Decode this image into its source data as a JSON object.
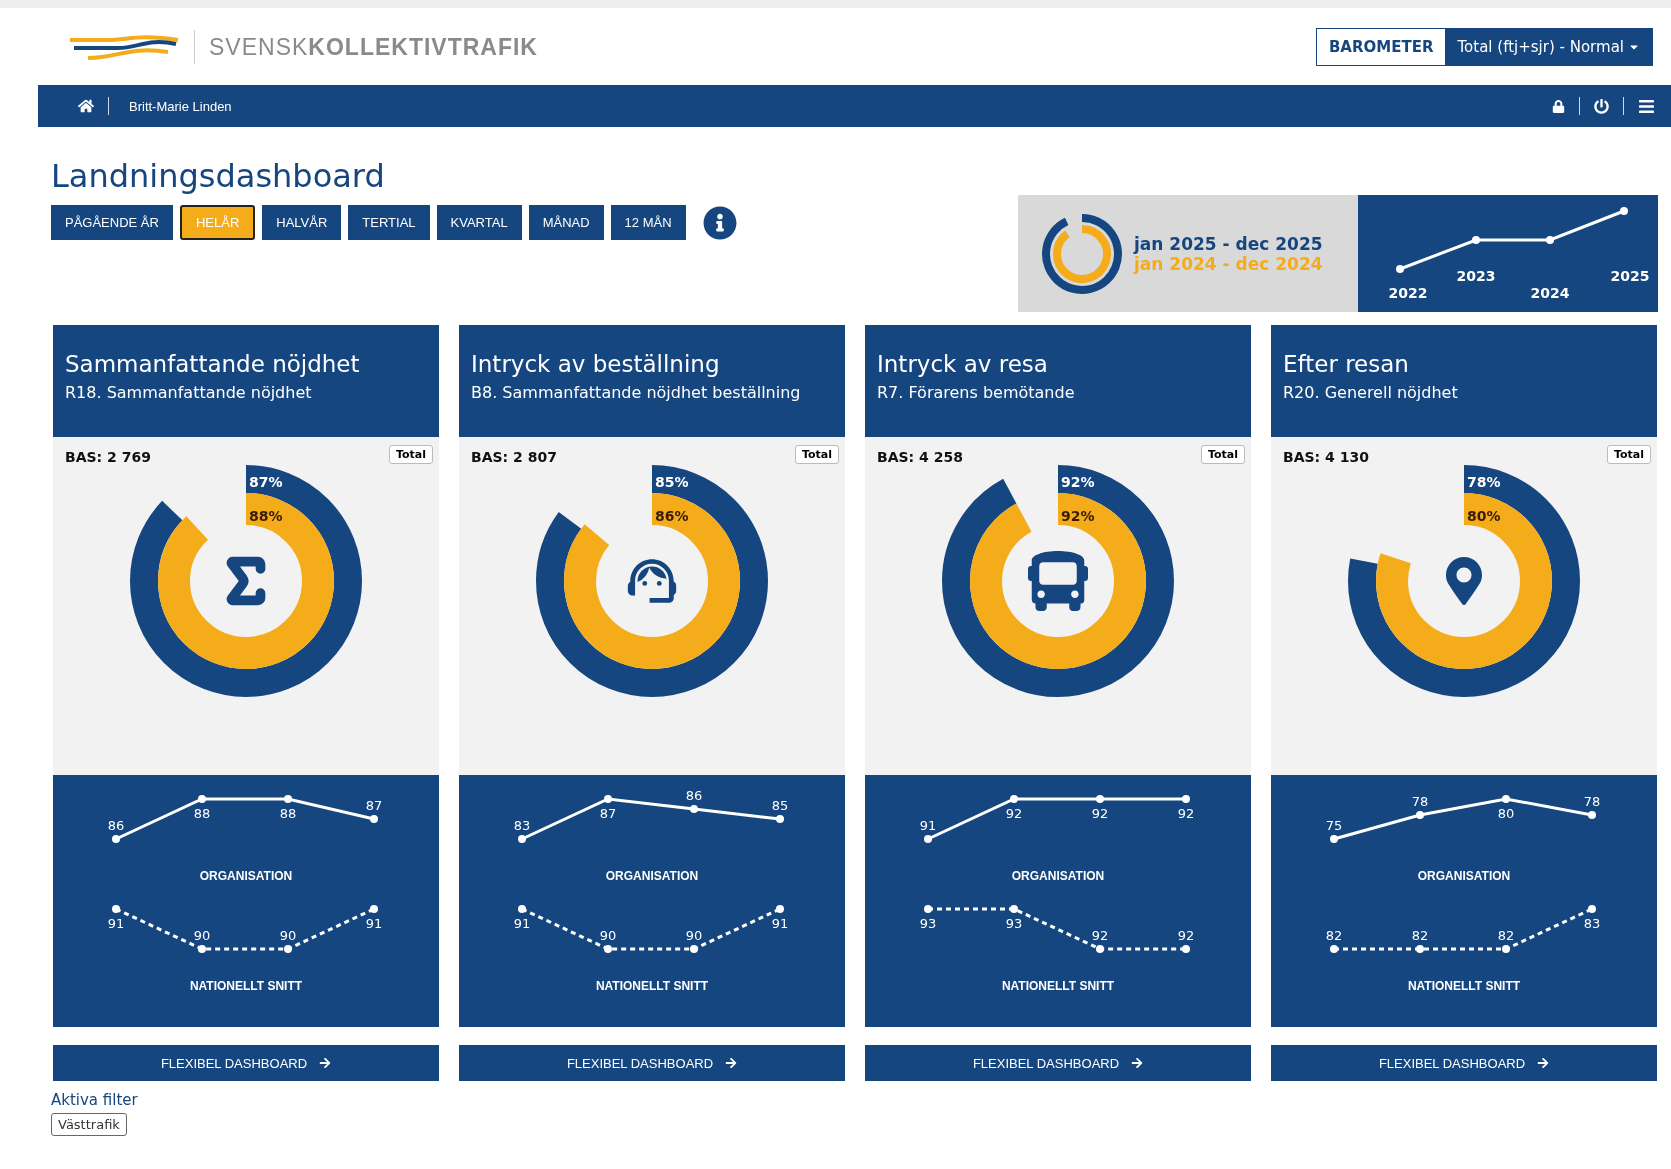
{
  "brand": {
    "wordmark": "SVENSK**KOLLEKTIVTRAFIK**"
  },
  "barometer": {
    "label": "BAROMETER",
    "value": "Total (ftj+sjr) - Normal"
  },
  "navbar": {
    "user": "Britt-Marie Linden"
  },
  "page_title": "Landningsdashboard",
  "periods": [
    {
      "label": "PÅGÅENDE ÅR",
      "selected": false
    },
    {
      "label": "HELÅR",
      "selected": true
    },
    {
      "label": "HALVÅR",
      "selected": false
    },
    {
      "label": "TERTIAL",
      "selected": false
    },
    {
      "label": "KVARTAL",
      "selected": false
    },
    {
      "label": "MÅNAD",
      "selected": false
    },
    {
      "label": "12 MÅN",
      "selected": false
    }
  ],
  "legend": {
    "current": "jan 2025 - dec 2025",
    "previous": "jan 2024 - dec 2024"
  },
  "trend": {
    "years": [
      "2022",
      "2023",
      "2024",
      "2025"
    ]
  },
  "cards": [
    {
      "title": "Sammanfattande nöjdhet",
      "subtitle": "R18. Sammanfattande nöjdhet",
      "base": "BAS: 2 769",
      "tag": "Total",
      "outer": {
        "label": "87%",
        "level": 0.87
      },
      "inner": {
        "label": "88%",
        "level": 0.88
      },
      "trends": [
        {
          "chart_data": {
            "type": "line",
            "series": [
              {
                "name": "ORGANISATION",
                "color": "#ffffff",
                "line_style": "solid",
                "marker": true,
                "values": [
                  86,
                  88,
                  88,
                  87
                ]
              }
            ],
            "data_labels": true
          }
        },
        {
          "chart_data": {
            "type": "line",
            "series": [
              {
                "name": "NATIONELLT SNITT",
                "color": "#ffffff",
                "line_style": "dashed",
                "marker": true,
                "values": [
                  91,
                  90,
                  90,
                  91
                ]
              }
            ],
            "data_labels": true
          }
        }
      ],
      "action": "FLEXIBEL DASHBOARD"
    },
    {
      "title": "Intryck av beställning",
      "subtitle": "B8. Sammanfattande nöjdhet beställning",
      "base": "BAS: 2 807",
      "tag": "Total",
      "outer": {
        "label": "85%",
        "level": 0.85
      },
      "inner": {
        "label": "86%",
        "level": 0.86
      },
      "trends": [
        {
          "chart_data": {
            "type": "line",
            "series": [
              {
                "name": "ORGANISATION",
                "color": "#ffffff",
                "line_style": "solid",
                "marker": true,
                "values": [
                  83,
                  87,
                  86,
                  85
                ]
              }
            ],
            "data_labels": true
          }
        },
        {
          "chart_data": {
            "type": "line",
            "series": [
              {
                "name": "NATIONELLT SNITT",
                "color": "#ffffff",
                "line_style": "dashed",
                "marker": true,
                "values": [
                  91,
                  90,
                  90,
                  91
                ]
              }
            ],
            "data_labels": true
          }
        }
      ],
      "action": "FLEXIBEL DASHBOARD"
    },
    {
      "title": "Intryck av resa",
      "subtitle": "R7. Förarens bemötande",
      "base": "BAS: 4 258",
      "tag": "Total",
      "outer": {
        "label": "92%",
        "level": 0.92
      },
      "inner": {
        "label": "92%",
        "level": 0.92
      },
      "trends": [
        {
          "chart_data": {
            "type": "line",
            "series": [
              {
                "name": "ORGANISATION",
                "color": "#ffffff",
                "line_style": "solid",
                "marker": true,
                "values": [
                  91,
                  92,
                  92,
                  92
                ]
              }
            ],
            "data_labels": true
          }
        },
        {
          "chart_data": {
            "type": "line",
            "series": [
              {
                "name": "NATIONELLT SNITT",
                "color": "#ffffff",
                "line_style": "dashed",
                "marker": true,
                "values": [
                  93,
                  93,
                  92,
                  92
                ]
              }
            ],
            "data_labels": true
          }
        }
      ],
      "action": "FLEXIBEL DASHBOARD"
    },
    {
      "title": "Efter resan",
      "subtitle": "R20. Generell nöjdhet",
      "base": "BAS: 4 130",
      "tag": "Total",
      "outer": {
        "label": "78%",
        "level": 0.78
      },
      "inner": {
        "label": "80%",
        "level": 0.8
      },
      "trends": [
        {
          "chart_data": {
            "type": "line",
            "series": [
              {
                "name": "ORGANISATION",
                "color": "#ffffff",
                "line_style": "solid",
                "marker": true,
                "values": [
                  75,
                  78,
                  80,
                  78
                ]
              }
            ],
            "data_labels": true
          }
        },
        {
          "chart_data": {
            "type": "line",
            "series": [
              {
                "name": "NATIONELLT SNITT",
                "color": "#ffffff",
                "line_style": "dashed",
                "marker": true,
                "values": [
                  82,
                  82,
                  82,
                  83
                ]
              }
            ],
            "data_labels": true
          }
        }
      ],
      "action": "FLEXIBEL DASHBOARD"
    }
  ],
  "filters": {
    "title": "Aktiva filter",
    "tags": [
      "Västtrafik"
    ]
  }
}
